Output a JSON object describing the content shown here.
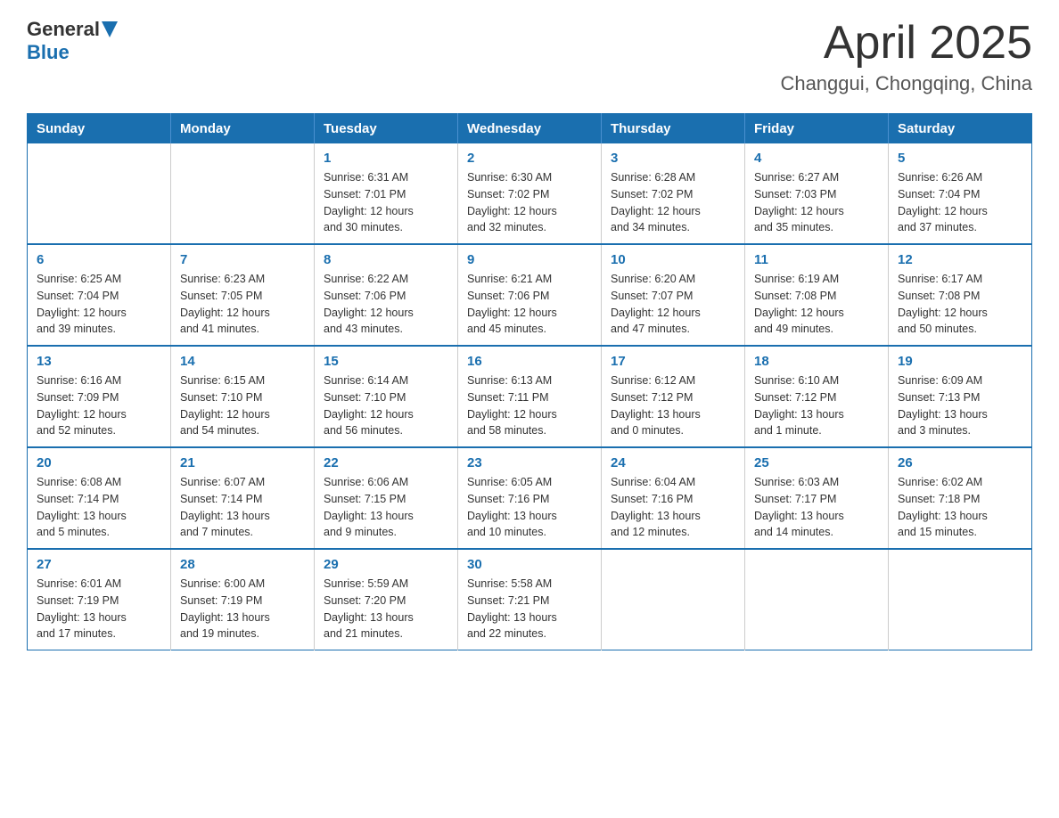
{
  "header": {
    "logo_general": "General",
    "logo_blue": "Blue",
    "month_title": "April 2025",
    "location": "Changgui, Chongqing, China"
  },
  "weekdays": [
    "Sunday",
    "Monday",
    "Tuesday",
    "Wednesday",
    "Thursday",
    "Friday",
    "Saturday"
  ],
  "weeks": [
    [
      {
        "day": "",
        "info": ""
      },
      {
        "day": "",
        "info": ""
      },
      {
        "day": "1",
        "info": "Sunrise: 6:31 AM\nSunset: 7:01 PM\nDaylight: 12 hours\nand 30 minutes."
      },
      {
        "day": "2",
        "info": "Sunrise: 6:30 AM\nSunset: 7:02 PM\nDaylight: 12 hours\nand 32 minutes."
      },
      {
        "day": "3",
        "info": "Sunrise: 6:28 AM\nSunset: 7:02 PM\nDaylight: 12 hours\nand 34 minutes."
      },
      {
        "day": "4",
        "info": "Sunrise: 6:27 AM\nSunset: 7:03 PM\nDaylight: 12 hours\nand 35 minutes."
      },
      {
        "day": "5",
        "info": "Sunrise: 6:26 AM\nSunset: 7:04 PM\nDaylight: 12 hours\nand 37 minutes."
      }
    ],
    [
      {
        "day": "6",
        "info": "Sunrise: 6:25 AM\nSunset: 7:04 PM\nDaylight: 12 hours\nand 39 minutes."
      },
      {
        "day": "7",
        "info": "Sunrise: 6:23 AM\nSunset: 7:05 PM\nDaylight: 12 hours\nand 41 minutes."
      },
      {
        "day": "8",
        "info": "Sunrise: 6:22 AM\nSunset: 7:06 PM\nDaylight: 12 hours\nand 43 minutes."
      },
      {
        "day": "9",
        "info": "Sunrise: 6:21 AM\nSunset: 7:06 PM\nDaylight: 12 hours\nand 45 minutes."
      },
      {
        "day": "10",
        "info": "Sunrise: 6:20 AM\nSunset: 7:07 PM\nDaylight: 12 hours\nand 47 minutes."
      },
      {
        "day": "11",
        "info": "Sunrise: 6:19 AM\nSunset: 7:08 PM\nDaylight: 12 hours\nand 49 minutes."
      },
      {
        "day": "12",
        "info": "Sunrise: 6:17 AM\nSunset: 7:08 PM\nDaylight: 12 hours\nand 50 minutes."
      }
    ],
    [
      {
        "day": "13",
        "info": "Sunrise: 6:16 AM\nSunset: 7:09 PM\nDaylight: 12 hours\nand 52 minutes."
      },
      {
        "day": "14",
        "info": "Sunrise: 6:15 AM\nSunset: 7:10 PM\nDaylight: 12 hours\nand 54 minutes."
      },
      {
        "day": "15",
        "info": "Sunrise: 6:14 AM\nSunset: 7:10 PM\nDaylight: 12 hours\nand 56 minutes."
      },
      {
        "day": "16",
        "info": "Sunrise: 6:13 AM\nSunset: 7:11 PM\nDaylight: 12 hours\nand 58 minutes."
      },
      {
        "day": "17",
        "info": "Sunrise: 6:12 AM\nSunset: 7:12 PM\nDaylight: 13 hours\nand 0 minutes."
      },
      {
        "day": "18",
        "info": "Sunrise: 6:10 AM\nSunset: 7:12 PM\nDaylight: 13 hours\nand 1 minute."
      },
      {
        "day": "19",
        "info": "Sunrise: 6:09 AM\nSunset: 7:13 PM\nDaylight: 13 hours\nand 3 minutes."
      }
    ],
    [
      {
        "day": "20",
        "info": "Sunrise: 6:08 AM\nSunset: 7:14 PM\nDaylight: 13 hours\nand 5 minutes."
      },
      {
        "day": "21",
        "info": "Sunrise: 6:07 AM\nSunset: 7:14 PM\nDaylight: 13 hours\nand 7 minutes."
      },
      {
        "day": "22",
        "info": "Sunrise: 6:06 AM\nSunset: 7:15 PM\nDaylight: 13 hours\nand 9 minutes."
      },
      {
        "day": "23",
        "info": "Sunrise: 6:05 AM\nSunset: 7:16 PM\nDaylight: 13 hours\nand 10 minutes."
      },
      {
        "day": "24",
        "info": "Sunrise: 6:04 AM\nSunset: 7:16 PM\nDaylight: 13 hours\nand 12 minutes."
      },
      {
        "day": "25",
        "info": "Sunrise: 6:03 AM\nSunset: 7:17 PM\nDaylight: 13 hours\nand 14 minutes."
      },
      {
        "day": "26",
        "info": "Sunrise: 6:02 AM\nSunset: 7:18 PM\nDaylight: 13 hours\nand 15 minutes."
      }
    ],
    [
      {
        "day": "27",
        "info": "Sunrise: 6:01 AM\nSunset: 7:19 PM\nDaylight: 13 hours\nand 17 minutes."
      },
      {
        "day": "28",
        "info": "Sunrise: 6:00 AM\nSunset: 7:19 PM\nDaylight: 13 hours\nand 19 minutes."
      },
      {
        "day": "29",
        "info": "Sunrise: 5:59 AM\nSunset: 7:20 PM\nDaylight: 13 hours\nand 21 minutes."
      },
      {
        "day": "30",
        "info": "Sunrise: 5:58 AM\nSunset: 7:21 PM\nDaylight: 13 hours\nand 22 minutes."
      },
      {
        "day": "",
        "info": ""
      },
      {
        "day": "",
        "info": ""
      },
      {
        "day": "",
        "info": ""
      }
    ]
  ]
}
